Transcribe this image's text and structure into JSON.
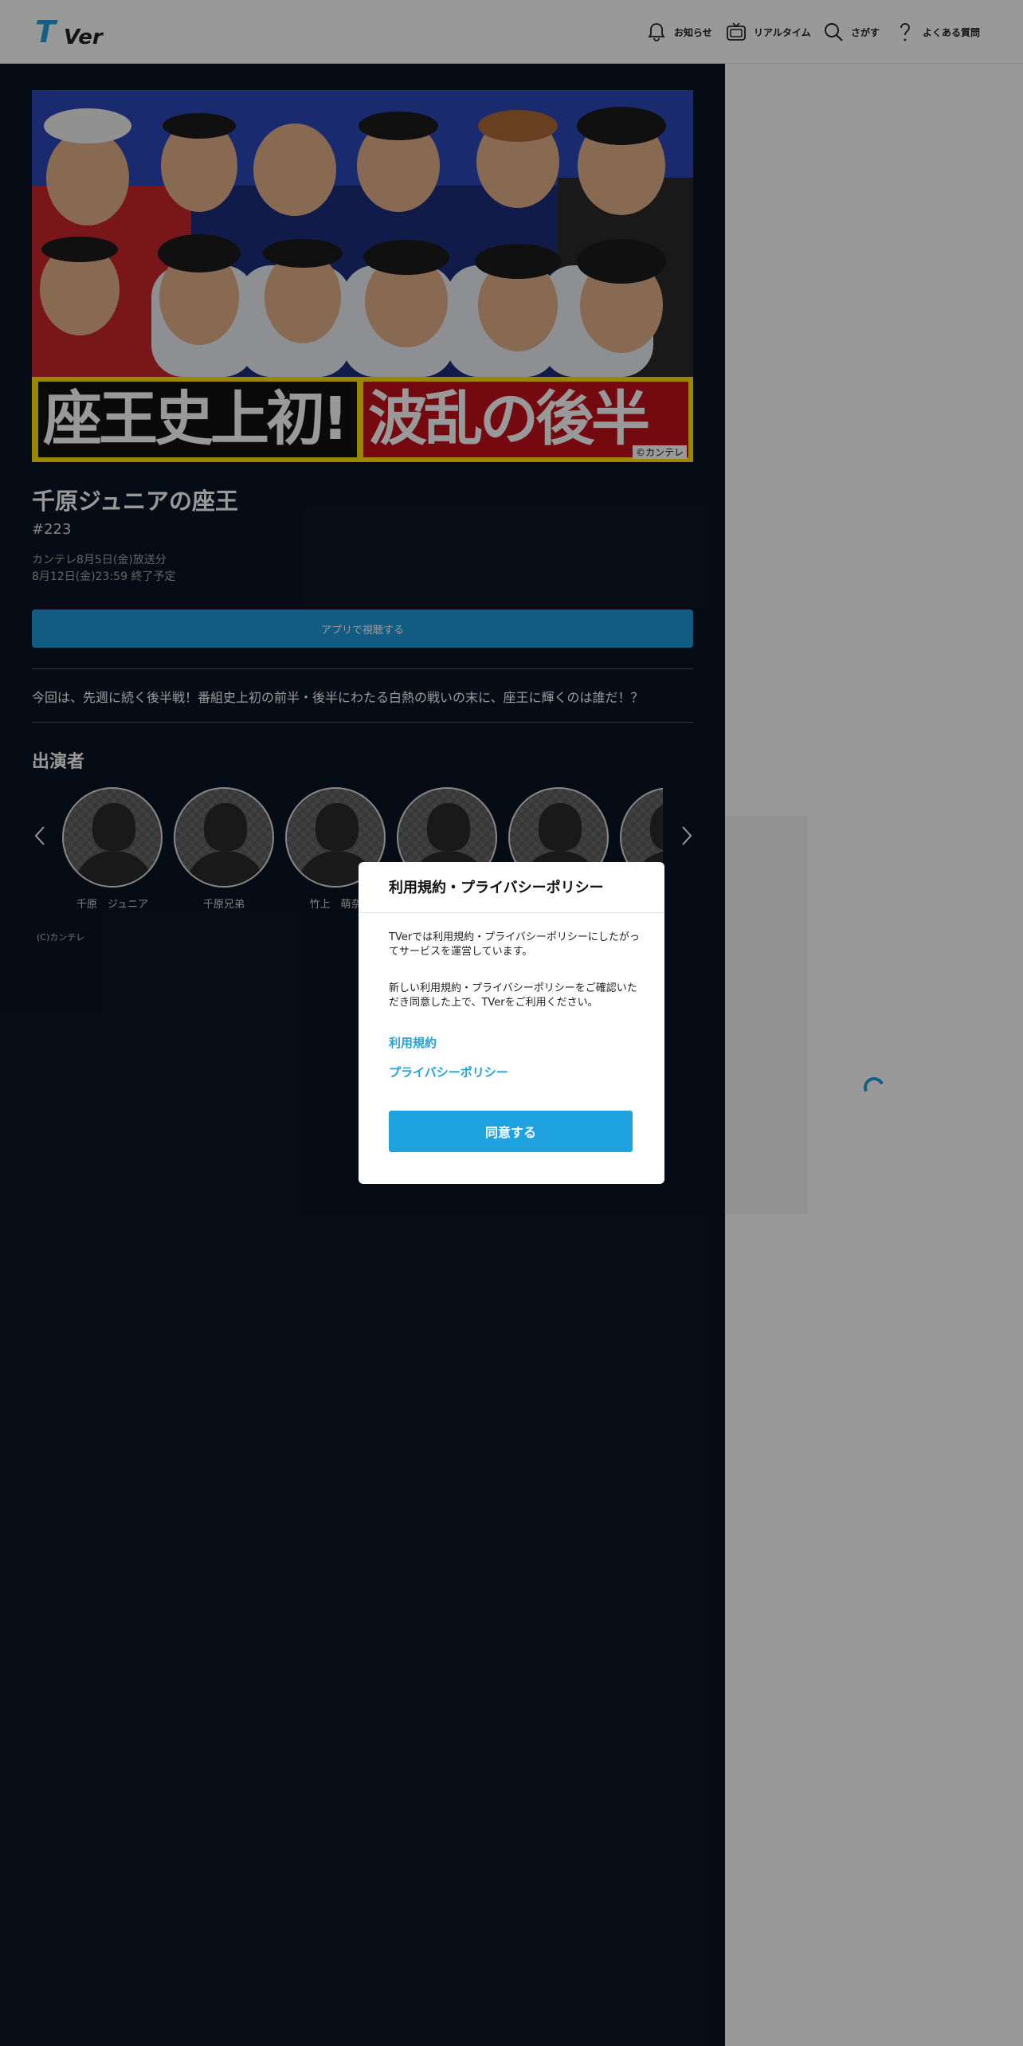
{
  "header": {
    "nav": [
      {
        "label": "お知らせ",
        "icon": "bell-icon"
      },
      {
        "label": "リアルタイム",
        "icon": "tv-icon"
      },
      {
        "label": "さがす",
        "icon": "search-icon"
      },
      {
        "label": "よくある質問",
        "icon": "question-icon"
      }
    ]
  },
  "episode": {
    "thumbnail_left_text": "座王史上初!",
    "thumbnail_right_text": "波乱の後半戦",
    "thumbnail_credit": "©カンテレ",
    "title": "千原ジュニアの座王",
    "number": "#223",
    "broadcast": "カンテレ8月5日(金)放送分",
    "expires": "8月12日(金)23:59 終了予定",
    "app_button": "アプリで視聴する",
    "description": "今回は、先週に続く後半戦！番組史上初の前半・後半にわたる白熱の戦いの末に、座王に輝くのは誰だ！？"
  },
  "cast": {
    "heading": "出演者",
    "members": [
      "千原　ジュニア",
      "千原兄弟",
      "竹上　萌奈",
      "",
      "",
      ""
    ]
  },
  "copyright": "(C)カンテレ",
  "modal": {
    "title": "利用規約・プライバシーポリシー",
    "p1": "TVerでは利用規約・プライバシーポリシーにしたがってサービスを運営しています。",
    "p2": "新しい利用規約・プライバシーポリシーをご確認いただき同意した上で、TVerをご利用ください。",
    "link_terms": "利用規約",
    "link_privacy": "プライバシーポリシー",
    "agree": "同意する"
  },
  "colors": {
    "brand": "#1ea0dc",
    "page_bg": "#0b1523",
    "button": "#1fa3e0"
  }
}
